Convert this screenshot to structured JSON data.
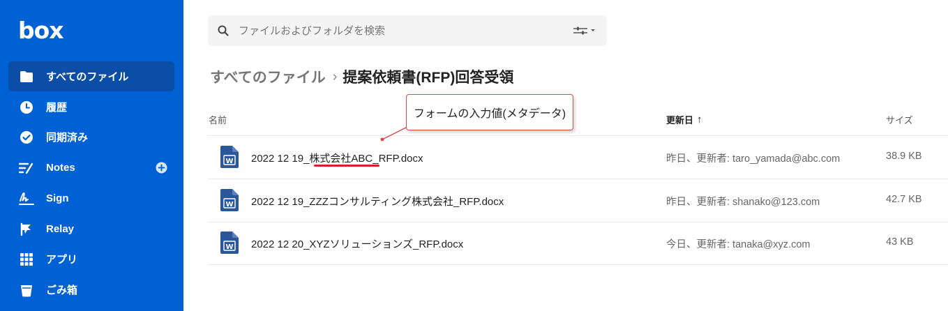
{
  "app": {
    "logo": "box"
  },
  "sidebar": {
    "items": [
      {
        "label": "すべてのファイル",
        "icon": "folder-icon",
        "active": true
      },
      {
        "label": "履歴",
        "icon": "clock-icon"
      },
      {
        "label": "同期済み",
        "icon": "check-circle-icon"
      },
      {
        "label": "Notes",
        "icon": "notes-icon",
        "action_icon": "plus-circle-icon"
      },
      {
        "label": "Sign",
        "icon": "sign-icon"
      },
      {
        "label": "Relay",
        "icon": "relay-icon"
      },
      {
        "label": "アプリ",
        "icon": "apps-grid-icon"
      },
      {
        "label": "ごみ箱",
        "icon": "trash-icon"
      }
    ]
  },
  "search": {
    "placeholder": "ファイルおよびフォルダを検索",
    "value": ""
  },
  "breadcrumb": {
    "root": "すべてのファイル",
    "separator": "›",
    "current": "提案依頼書(RFP)回答受領"
  },
  "table": {
    "columns": {
      "name": "名前",
      "updated": "更新日",
      "size": "サイズ"
    },
    "sort_indicator": "↑",
    "rows": [
      {
        "name": "2022 12 19_株式会社ABC_RFP.docx",
        "updated": "昨日、更新者: taro_yamada@abc.com",
        "size": "38.9 KB"
      },
      {
        "name": "2022 12 19_ZZZコンサルティング株式会社_RFP.docx",
        "updated": "昨日、更新者: shanako@123.com",
        "size": "42.7 KB"
      },
      {
        "name": "2022 12 20_XYZソリューションズ_RFP.docx",
        "updated": "今日、更新者: tanaka@xyz.com",
        "size": "43 KB"
      }
    ]
  },
  "annotation": {
    "callout_text": "フォームの入力値(メタデータ)"
  },
  "colors": {
    "sidebar_bg": "#0061d5",
    "active_item_bg": "#0b4ea8",
    "word_icon": "#2b579a",
    "annotation_red": "#d61f2a"
  }
}
